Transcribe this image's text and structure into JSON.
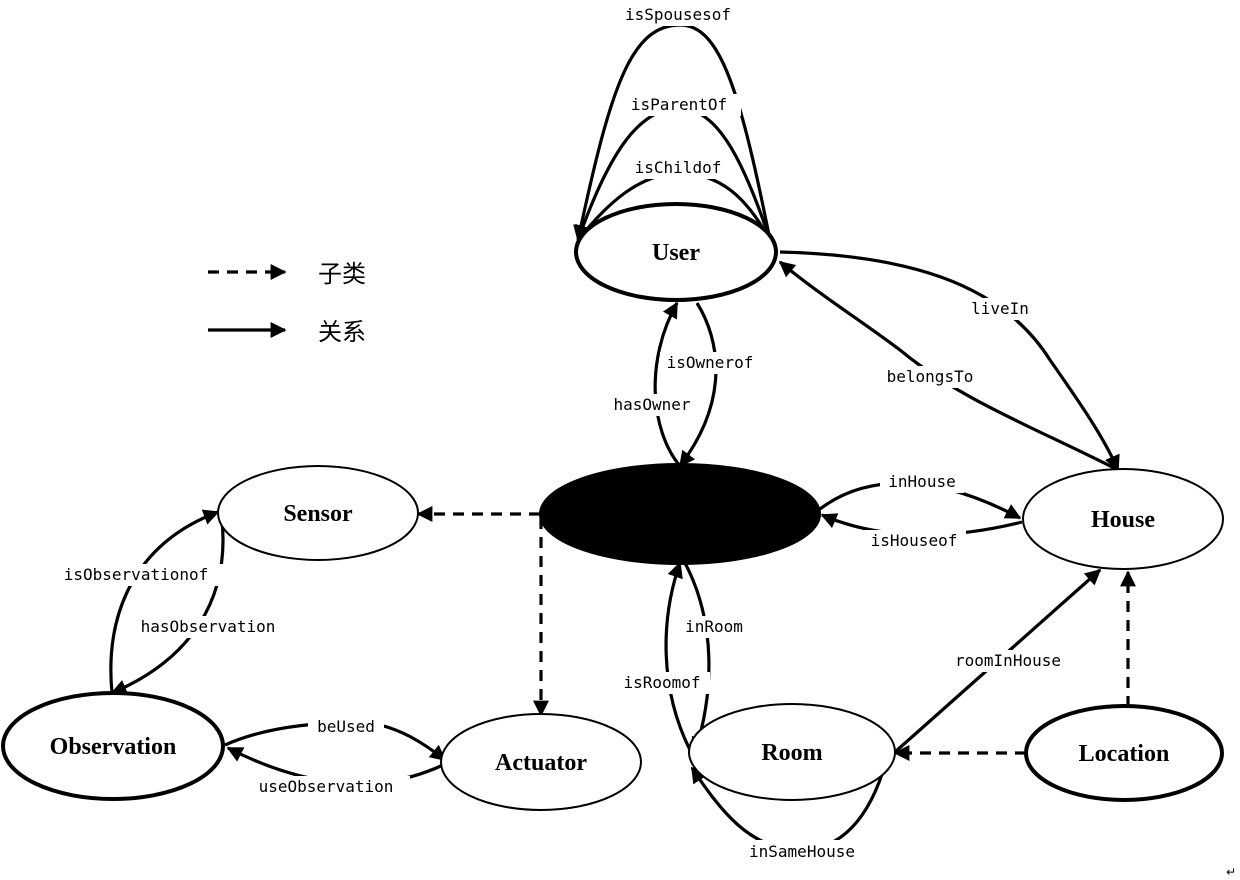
{
  "legend": {
    "subclass_label": "子类",
    "relation_label": "关系"
  },
  "nodes": {
    "user": "User",
    "device": "",
    "sensor": "Sensor",
    "house": "House",
    "observation": "Observation",
    "actuator": "Actuator",
    "room": "Room",
    "location": "Location"
  },
  "edges": {
    "isSpouseof": "isSpousesof",
    "isParentOf": "isParentOf",
    "isChildof": "isChildof",
    "liveIn": "liveIn",
    "belongsTo": "belongsTo",
    "isOwnerof": "isOwnerof",
    "hasOwner": "hasOwner",
    "inHouse": "inHouse",
    "isHouseof": "isHouseof",
    "isObservationof": "isObservationof",
    "hasObservation": "hasObservation",
    "beUsed": "beUsed",
    "useObservation": "useObservation",
    "inRoom": "inRoom",
    "isRoomof": "isRoomof",
    "roomInHouse": "roomInHouse",
    "inSameHouse": "inSameHouse"
  },
  "colors": {
    "line": "#000000",
    "background": "#ffffff"
  },
  "paragraph_mark": "↵"
}
